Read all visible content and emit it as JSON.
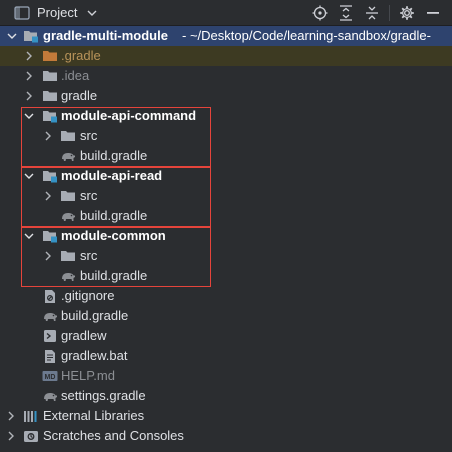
{
  "header": {
    "title": "Project",
    "icons": [
      "folder-icon",
      "chevron-down-icon",
      "target-icon",
      "expand-all-icon",
      "collapse-all-icon",
      "gear-icon",
      "minimize-icon"
    ]
  },
  "tree": {
    "root": {
      "name": "gradle-multi-module",
      "path": " - ~/Desktop/Code/learning-sandbox/gradle-"
    },
    "gradle_dir": ".gradle",
    "idea_dir": ".idea",
    "gradle_folder": "gradle",
    "modules": [
      {
        "name": "module-api-command",
        "src": "src",
        "build": "build.gradle"
      },
      {
        "name": "module-api-read",
        "src": "src",
        "build": "build.gradle"
      },
      {
        "name": "module-common",
        "src": "src",
        "build": "build.gradle"
      }
    ],
    "files": {
      "gitignore": ".gitignore",
      "build": "build.gradle",
      "gradlew": "gradlew",
      "gradlew_bat": "gradlew.bat",
      "help": "HELP.md",
      "help_badge": "MD",
      "settings": "settings.gradle"
    },
    "external_libraries": "External Libraries",
    "scratches": "Scratches and Consoles"
  },
  "colors": {
    "background": "#2b2d30",
    "selection": "#2e436e",
    "highlight_box": "#e5443b",
    "module_badge": "#3592c4"
  }
}
